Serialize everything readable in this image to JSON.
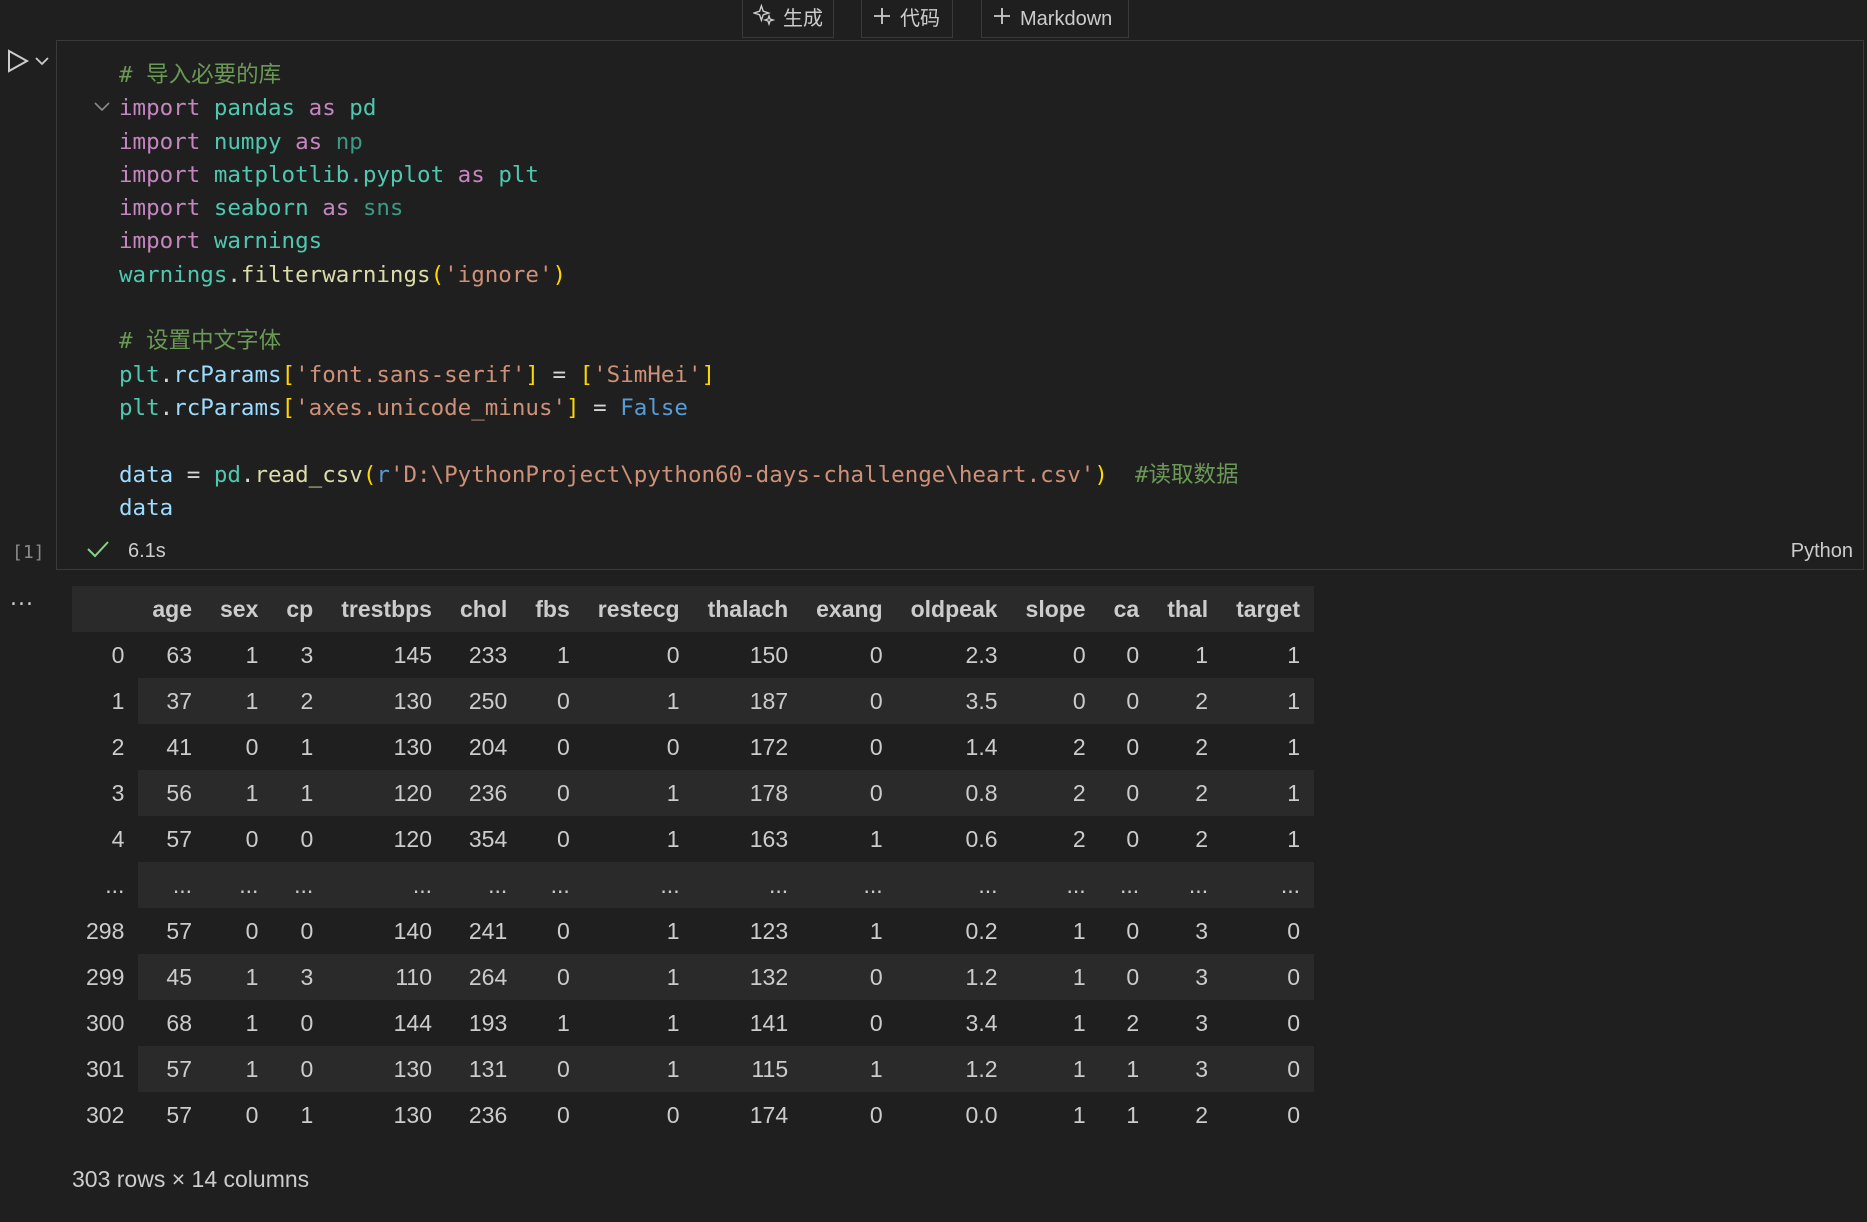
{
  "toolbar": {
    "generate_label": "生成",
    "code_label": "代码",
    "markdown_label": "Markdown"
  },
  "cell": {
    "execution_count": "[1]",
    "exec_time": "6.1s",
    "language": "Python",
    "code": {
      "comment1": "# 导入必要的库",
      "comment2": "# 设置中文字体",
      "comment3": "#读取数据",
      "import_kw": "import",
      "as_kw": "as",
      "pandas": "pandas",
      "pd": "pd",
      "numpy": "numpy",
      "np": "np",
      "mpl": "matplotlib.pyplot",
      "plt": "plt",
      "seaborn": "seaborn",
      "sns": "sns",
      "warnings": "warnings",
      "filterwarnings": "filterwarnings",
      "ignore_str": "'ignore'",
      "rcParams": "rcParams",
      "font_key": "'font.sans-serif'",
      "simhei": "'SimHei'",
      "axes_key": "'axes.unicode_minus'",
      "false_kw": "False",
      "data_var": "data",
      "read_csv": "read_csv",
      "r_prefix": "r",
      "path_str": "'D:\\PythonProject\\python60-days-challenge\\heart.csv'"
    }
  },
  "output": {
    "menu": "...",
    "columns": [
      "",
      "age",
      "sex",
      "cp",
      "trestbps",
      "chol",
      "fbs",
      "restecg",
      "thalach",
      "exang",
      "oldpeak",
      "slope",
      "ca",
      "thal",
      "target"
    ],
    "rows": [
      [
        "0",
        "63",
        "1",
        "3",
        "145",
        "233",
        "1",
        "0",
        "150",
        "0",
        "2.3",
        "0",
        "0",
        "1",
        "1"
      ],
      [
        "1",
        "37",
        "1",
        "2",
        "130",
        "250",
        "0",
        "1",
        "187",
        "0",
        "3.5",
        "0",
        "0",
        "2",
        "1"
      ],
      [
        "2",
        "41",
        "0",
        "1",
        "130",
        "204",
        "0",
        "0",
        "172",
        "0",
        "1.4",
        "2",
        "0",
        "2",
        "1"
      ],
      [
        "3",
        "56",
        "1",
        "1",
        "120",
        "236",
        "0",
        "1",
        "178",
        "0",
        "0.8",
        "2",
        "0",
        "2",
        "1"
      ],
      [
        "4",
        "57",
        "0",
        "0",
        "120",
        "354",
        "0",
        "1",
        "163",
        "1",
        "0.6",
        "2",
        "0",
        "2",
        "1"
      ],
      [
        "...",
        "...",
        "...",
        "...",
        "...",
        "...",
        "...",
        "...",
        "...",
        "...",
        "...",
        "...",
        "...",
        "...",
        "..."
      ],
      [
        "298",
        "57",
        "0",
        "0",
        "140",
        "241",
        "0",
        "1",
        "123",
        "1",
        "0.2",
        "1",
        "0",
        "3",
        "0"
      ],
      [
        "299",
        "45",
        "1",
        "3",
        "110",
        "264",
        "0",
        "1",
        "132",
        "0",
        "1.2",
        "1",
        "0",
        "3",
        "0"
      ],
      [
        "300",
        "68",
        "1",
        "0",
        "144",
        "193",
        "1",
        "1",
        "141",
        "0",
        "3.4",
        "1",
        "2",
        "3",
        "0"
      ],
      [
        "301",
        "57",
        "1",
        "0",
        "130",
        "131",
        "0",
        "1",
        "115",
        "1",
        "1.2",
        "1",
        "1",
        "3",
        "0"
      ],
      [
        "302",
        "57",
        "0",
        "1",
        "130",
        "236",
        "0",
        "0",
        "174",
        "0",
        "0.0",
        "1",
        "1",
        "2",
        "0"
      ]
    ],
    "shape_text": "303 rows × 14 columns"
  }
}
